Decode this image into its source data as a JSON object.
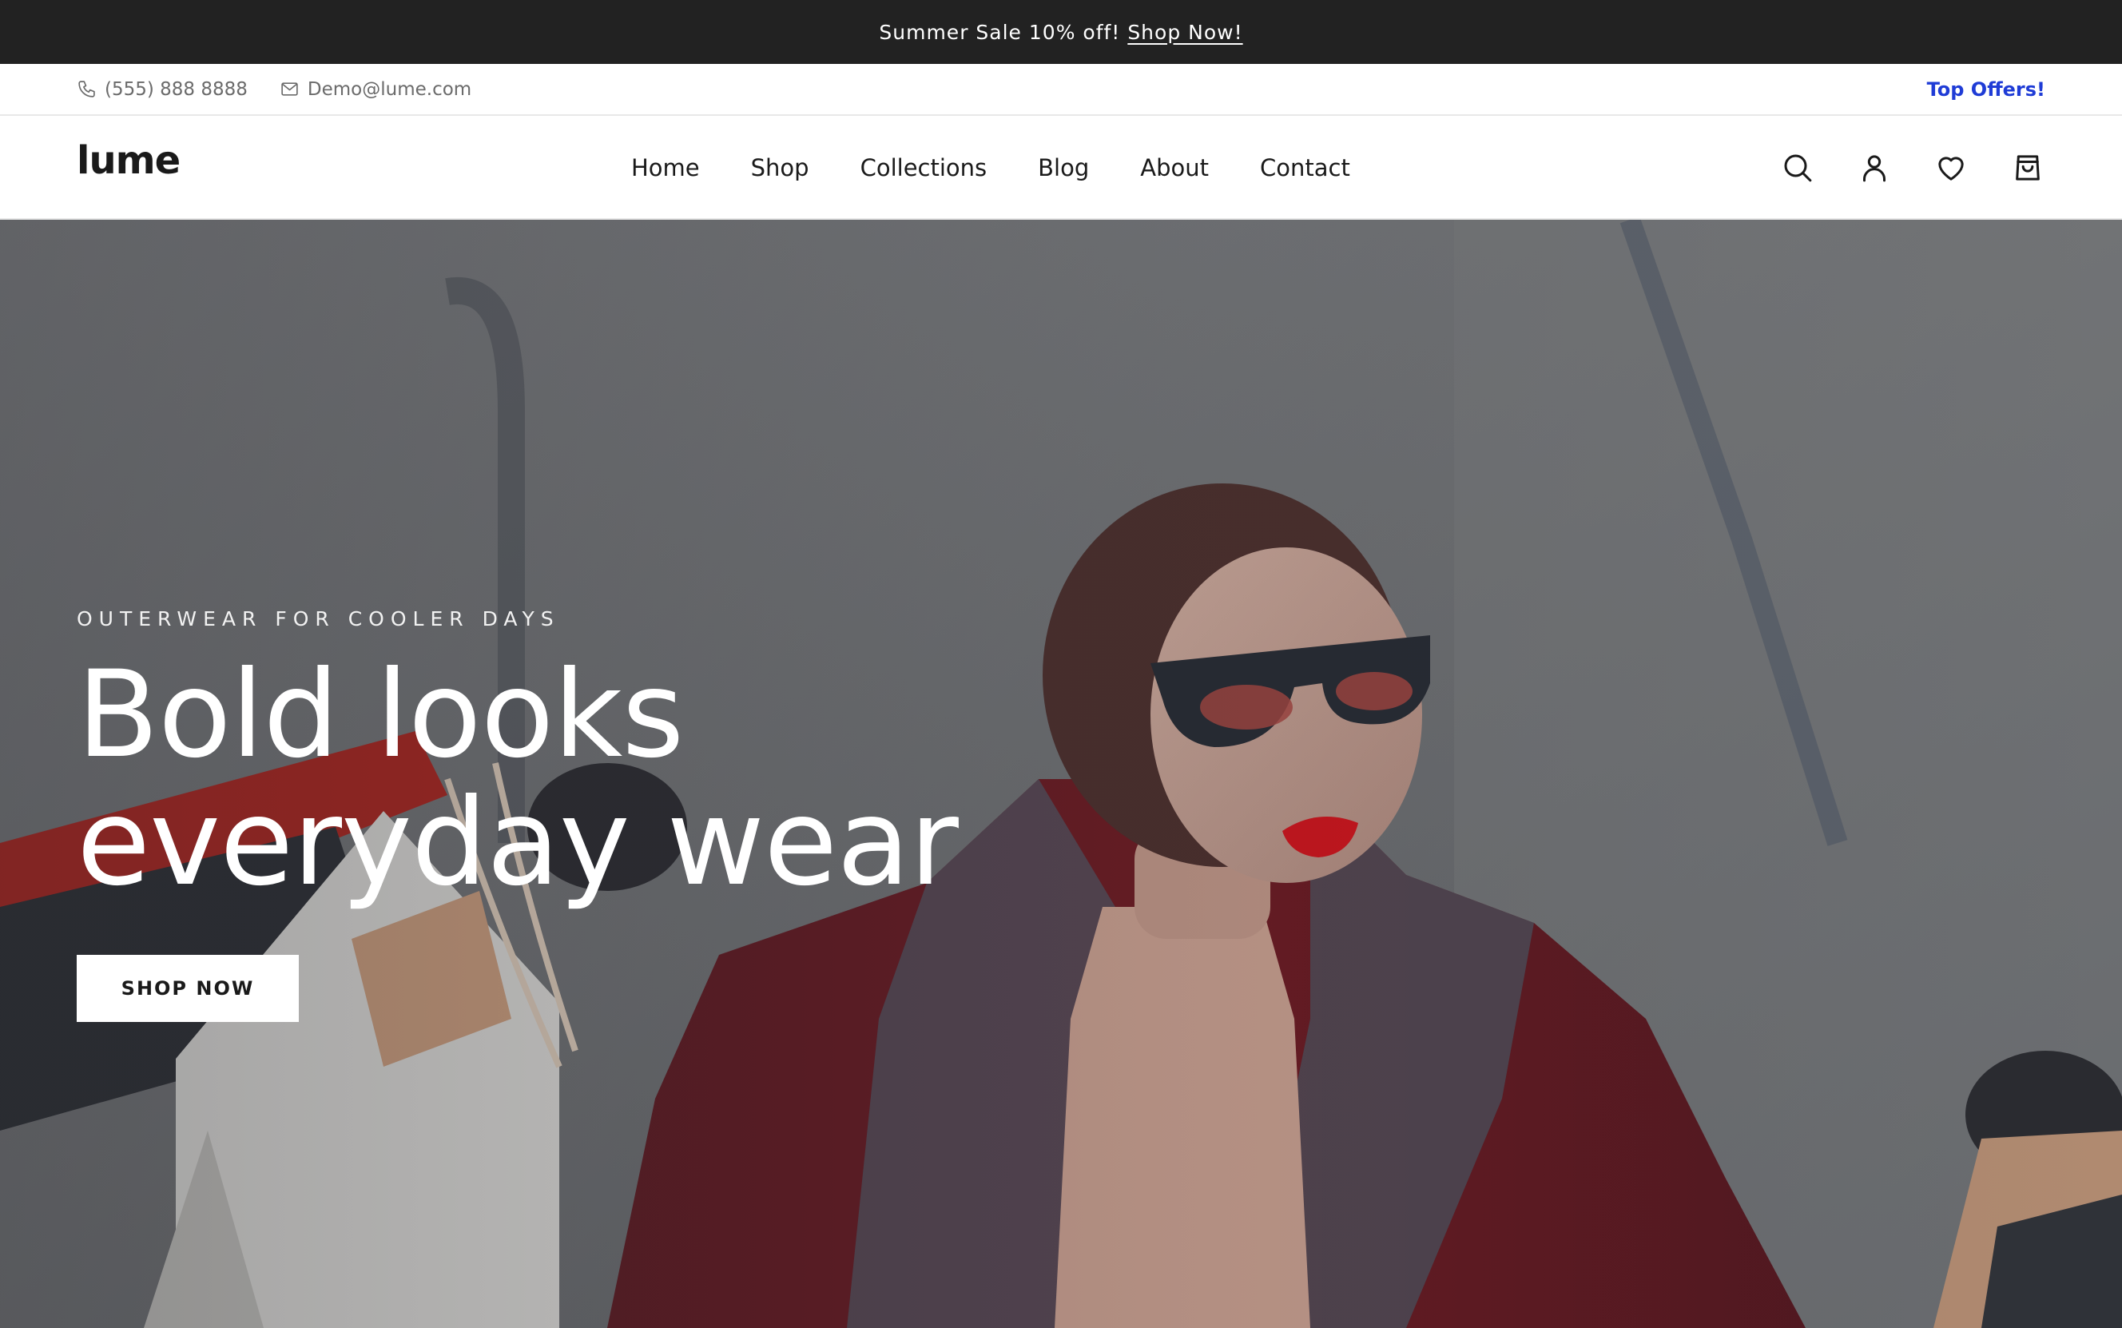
{
  "announcement": {
    "text": "Summer Sale 10% off!",
    "link": "Shop Now!"
  },
  "infobar": {
    "phone": "(555) 888 8888",
    "email": "Demo@lume.com",
    "offers": "Top Offers!"
  },
  "header": {
    "logo": "lume",
    "nav": [
      {
        "label": "Home"
      },
      {
        "label": "Shop"
      },
      {
        "label": "Collections"
      },
      {
        "label": "Blog"
      },
      {
        "label": "About"
      },
      {
        "label": "Contact"
      }
    ],
    "icons": [
      "search-icon",
      "account-icon",
      "wishlist-heart-icon",
      "cart-bag-icon"
    ]
  },
  "hero": {
    "eyebrow": "OUTERWEAR FOR COOLER DAYS",
    "title": "Bold looks everyday wear",
    "button": "SHOP NOW"
  },
  "colors": {
    "announcement_bg": "#222222",
    "offers_link": "#1f3cd6",
    "coat": "#6b1a22",
    "lips": "#c8141c"
  }
}
